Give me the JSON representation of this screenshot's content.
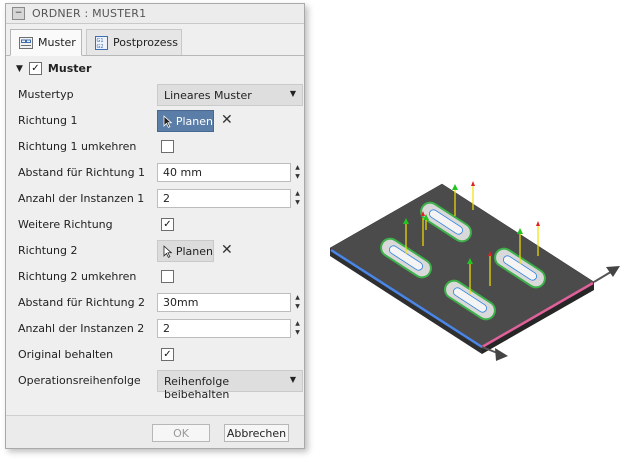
{
  "dialog": {
    "title": "ORDNER : MUSTER1",
    "tabs": [
      {
        "label": "Muster",
        "active": true
      },
      {
        "label": "Postprozess",
        "active": false
      }
    ],
    "section": {
      "label": "Muster",
      "checked": true
    },
    "rows": {
      "mustertyp": {
        "label": "Mustertyp",
        "value": "Lineares Muster"
      },
      "richtung1": {
        "label": "Richtung 1",
        "button": "Planen"
      },
      "richtung1_umkehren": {
        "label": "Richtung 1 umkehren",
        "checked": false
      },
      "abstand1": {
        "label": "Abstand für Richtung 1",
        "value": "40 mm"
      },
      "anzahl1": {
        "label": "Anzahl der Instanzen 1",
        "value": "2"
      },
      "weitere": {
        "label": "Weitere Richtung",
        "checked": true
      },
      "richtung2": {
        "label": "Richtung 2",
        "button": "Planen"
      },
      "richtung2_umkehren": {
        "label": "Richtung 2 umkehren",
        "checked": false
      },
      "abstand2": {
        "label": "Abstand für Richtung 2",
        "value": "30mm"
      },
      "anzahl2": {
        "label": "Anzahl der Instanzen 2",
        "value": "2"
      },
      "original": {
        "label": "Original behalten",
        "checked": true
      },
      "reihenfolge": {
        "label": "Operationsreihenfolge",
        "value": "Reihenfolge beibehalten"
      }
    },
    "buttons": {
      "ok": "OK",
      "cancel": "Abbrechen"
    }
  },
  "colors": {
    "selection_active": "#5b7ea8",
    "edge_direction1": "#4a86e8",
    "edge_direction2": "#e0609a",
    "pocket_green": "#3db04a"
  }
}
